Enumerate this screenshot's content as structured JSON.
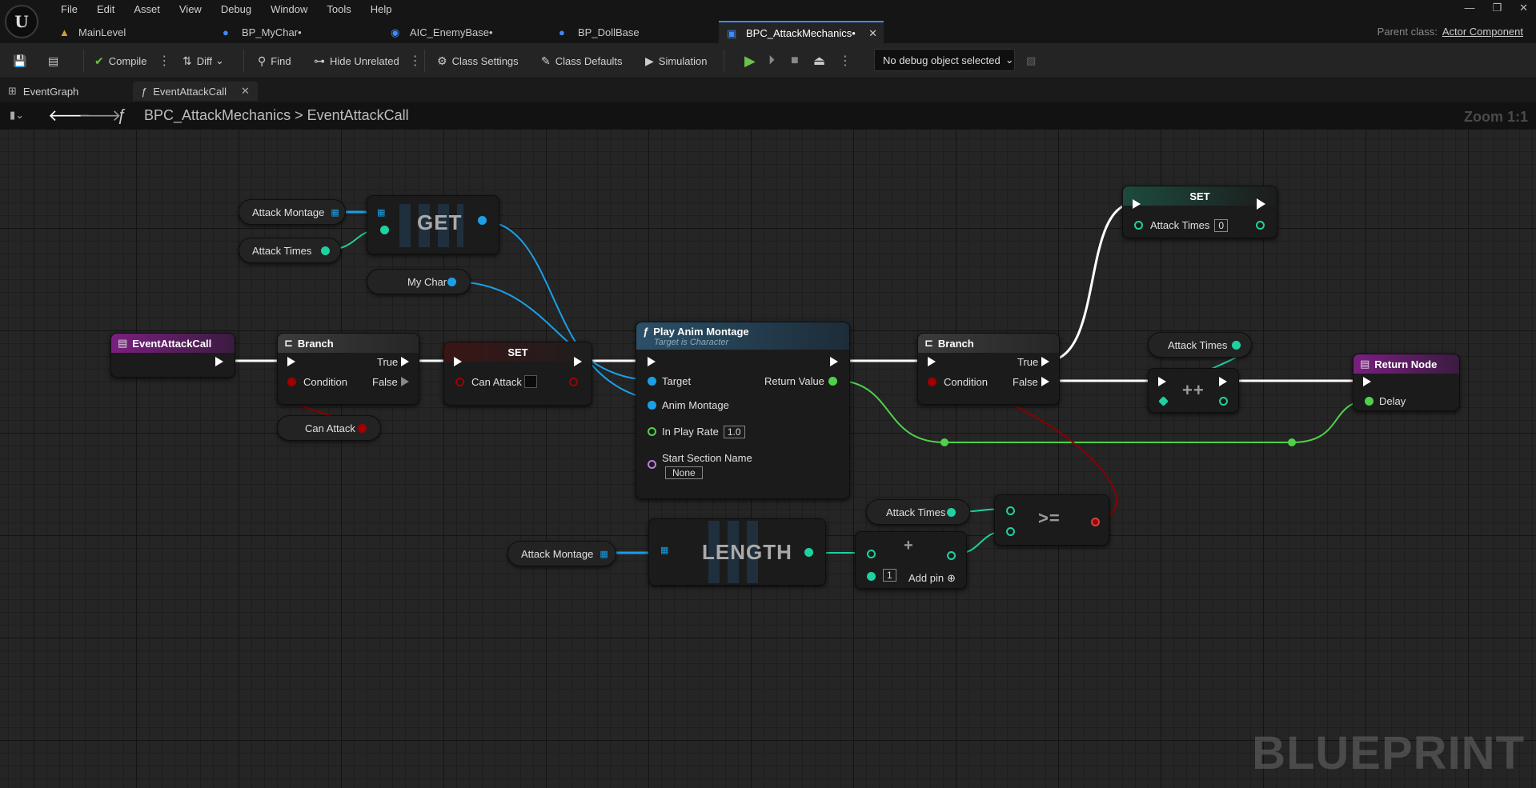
{
  "menu": [
    "File",
    "Edit",
    "Asset",
    "View",
    "Debug",
    "Window",
    "Tools",
    "Help"
  ],
  "tabs": [
    {
      "label": "MainLevel"
    },
    {
      "label": "BP_MyChar•"
    },
    {
      "label": "AIC_EnemyBase•"
    },
    {
      "label": "BP_DollBase"
    },
    {
      "label": "BPC_AttackMechanics•"
    }
  ],
  "parent_class": {
    "label": "Parent class:",
    "value": "Actor Component"
  },
  "toolbar": {
    "compile": "Compile",
    "diff": "Diff",
    "find": "Find",
    "hide_unrelated": "Hide Unrelated",
    "class_settings": "Class Settings",
    "class_defaults": "Class Defaults",
    "simulation": "Simulation",
    "debug_object": "No debug object selected"
  },
  "graph_tabs": {
    "event_graph": "EventGraph",
    "function": "EventAttackCall"
  },
  "breadcrumb": {
    "root": "BPC_AttackMechanics",
    "sep": ">",
    "current": "EventAttackCall",
    "zoom": "Zoom 1:1"
  },
  "watermark": "BLUEPRINT",
  "nodes": {
    "attack_montage_get": "Attack Montage",
    "attack_times_get": "Attack Times",
    "get_label": "GET",
    "my_char": "My Char",
    "event": "EventAttackCall",
    "branch1": {
      "title": "Branch",
      "true": "True",
      "false": "False",
      "condition": "Condition"
    },
    "can_attack_get": "Can Attack",
    "set1": {
      "title": "SET",
      "pin": "Can Attack"
    },
    "play_anim": {
      "title": "Play Anim Montage",
      "subtitle": "Target is Character",
      "target": "Target",
      "anim": "Anim Montage",
      "rate": "In Play Rate",
      "rate_val": "1.0",
      "section": "Start Section Name",
      "section_val": "None",
      "ret": "Return Value"
    },
    "branch2": {
      "title": "Branch",
      "true": "True",
      "false": "False",
      "condition": "Condition"
    },
    "set2": {
      "title": "SET",
      "pin": "Attack Times",
      "val": "0"
    },
    "attack_times_inc": "Attack Times",
    "inc_label": "++",
    "return_node": {
      "title": "Return Node",
      "delay": "Delay"
    },
    "attack_times_cmp": "Attack Times",
    "cmp_label": ">=",
    "attack_montage_len": "Attack Montage",
    "length_label": "LENGTH",
    "add": {
      "label": "+",
      "val": "1",
      "add_pin": "Add pin"
    }
  },
  "colors": {
    "exec": "#ffffff",
    "object": "#1aa0e8",
    "int": "#1fd1a0",
    "bool": "#a00000",
    "float": "#4fd14a",
    "name": "#c07ce0"
  }
}
